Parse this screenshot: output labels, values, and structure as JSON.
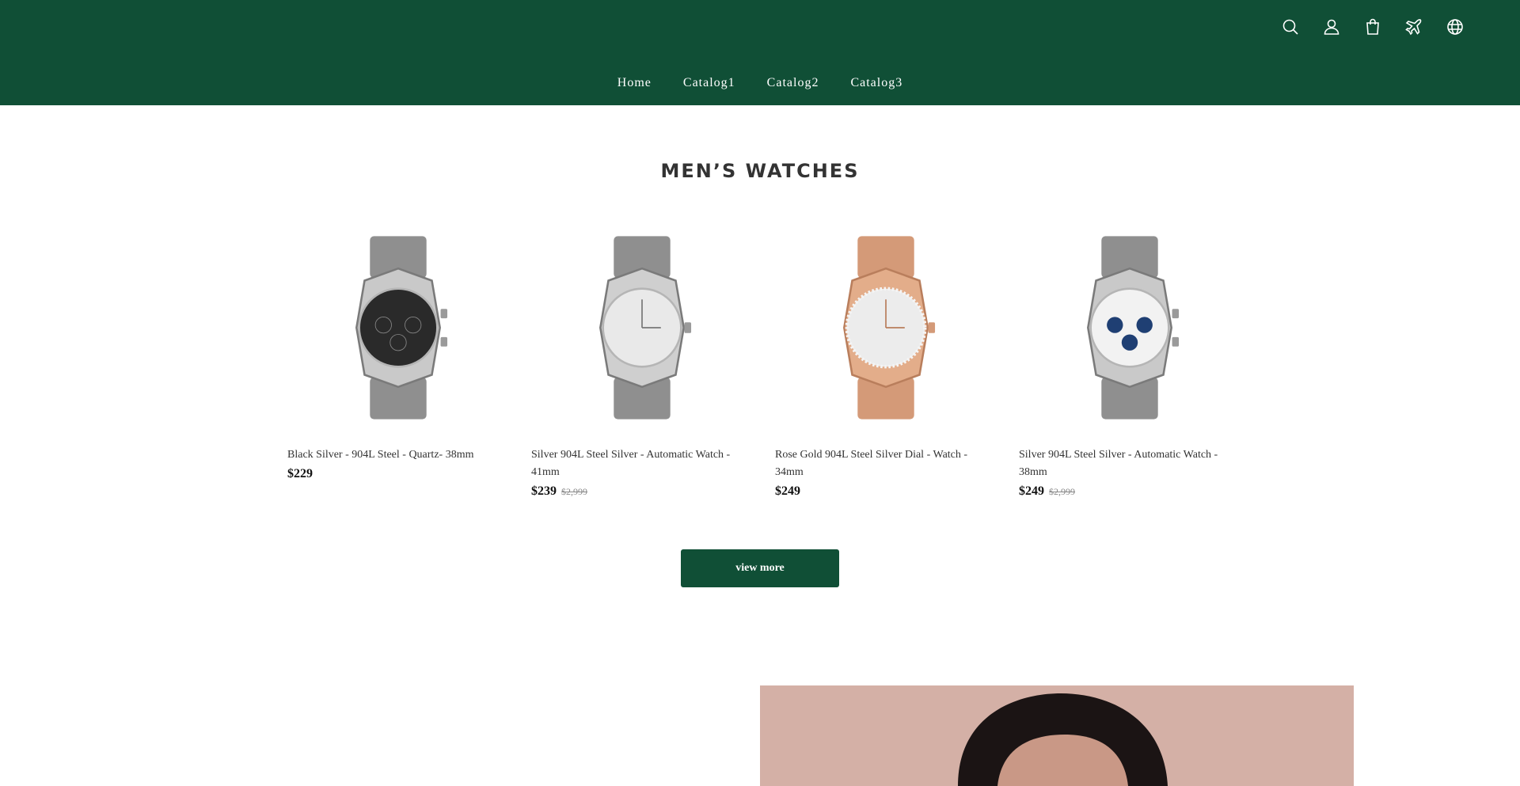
{
  "colors": {
    "brand": "#104f36",
    "promo_bg": "#d4b0a6"
  },
  "header": {
    "icons": [
      "search-icon",
      "account-icon",
      "cart-icon",
      "plane-icon",
      "globe-icon"
    ],
    "nav": [
      "Home",
      "Catalog1",
      "Catalog2",
      "Catalog3"
    ]
  },
  "section": {
    "title": "MEN’S WATCHES",
    "products": [
      {
        "title": "Black Silver - 904L Steel - Quartz- 38mm",
        "price": "$229",
        "compare_price": "",
        "dial": "#2a2a2a",
        "case": "silver"
      },
      {
        "title": "Silver 904L Steel Silver - Automatic Watch - 41mm",
        "price": "$239",
        "compare_price": "$2,999",
        "dial": "#e9e9e9",
        "case": "silver"
      },
      {
        "title": "Rose Gold 904L Steel Silver Dial - Watch - 34mm",
        "price": "$249",
        "compare_price": "",
        "dial": "#ececec",
        "case": "rose-gold"
      },
      {
        "title": "Silver 904L Steel Silver - Automatic Watch - 38mm",
        "price": "$249",
        "compare_price": "$2,999",
        "dial": "#f2f2f2",
        "case": "silver-blue"
      }
    ],
    "view_more_label": "view more"
  }
}
